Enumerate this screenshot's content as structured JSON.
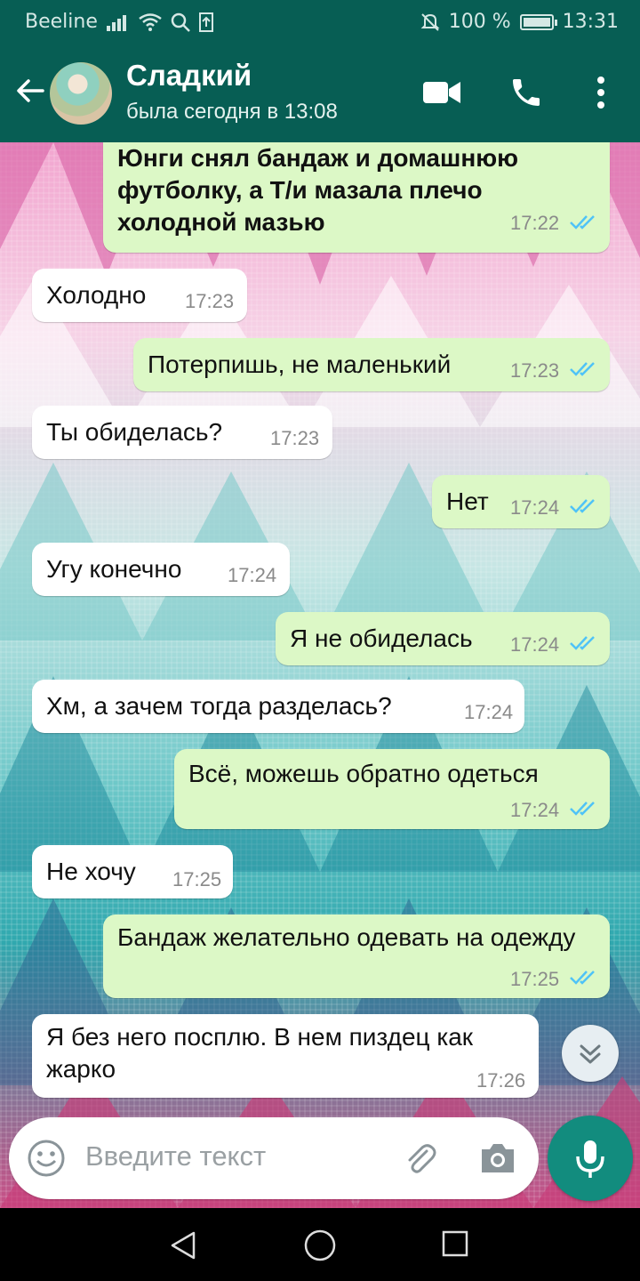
{
  "status_bar": {
    "carrier": "Beeline",
    "battery": "100 %",
    "time": "13:31"
  },
  "header": {
    "contact_name": "Сладкий",
    "last_seen": "была сегодня в 13:08",
    "accent_color": "#075E54"
  },
  "messages": [
    {
      "direction": "out",
      "text": "Юнги снял бандаж и домашнюю футболку, а Т/и мазала плечо холодной мазью",
      "time": "17:22",
      "read": true
    },
    {
      "direction": "in",
      "text": "Холодно",
      "time": "17:23"
    },
    {
      "direction": "out",
      "text": "Потерпишь, не маленький",
      "time": "17:23",
      "read": true
    },
    {
      "direction": "in",
      "text": "Ты обиделась?",
      "time": "17:23"
    },
    {
      "direction": "out",
      "text": "Нет",
      "time": "17:24",
      "read": true
    },
    {
      "direction": "in",
      "text": "Угу конечно",
      "time": "17:24"
    },
    {
      "direction": "out",
      "text": "Я не обиделась",
      "time": "17:24",
      "read": true
    },
    {
      "direction": "in",
      "text": "Хм, а зачем тогда разделась?",
      "time": "17:24"
    },
    {
      "direction": "out",
      "text": "Всё, можешь обратно одеться",
      "time": "17:24",
      "read": true
    },
    {
      "direction": "in",
      "text": "Не хочу",
      "time": "17:25"
    },
    {
      "direction": "out",
      "text": "Бандаж желательно одевать на одежду",
      "time": "17:25",
      "read": true
    },
    {
      "direction": "in",
      "text": "Я без него посплю. В нем пиздец как жарко",
      "time": "17:26"
    }
  ],
  "composer": {
    "placeholder": "Введите текст"
  },
  "icons": [
    "back-arrow-icon",
    "video-call-icon",
    "phone-icon",
    "more-vert-icon",
    "emoji-icon",
    "attach-icon",
    "camera-icon",
    "mic-icon",
    "chevron-double-down-icon",
    "nav-back-icon",
    "nav-home-icon",
    "nav-recents-icon",
    "double-check-icon"
  ]
}
